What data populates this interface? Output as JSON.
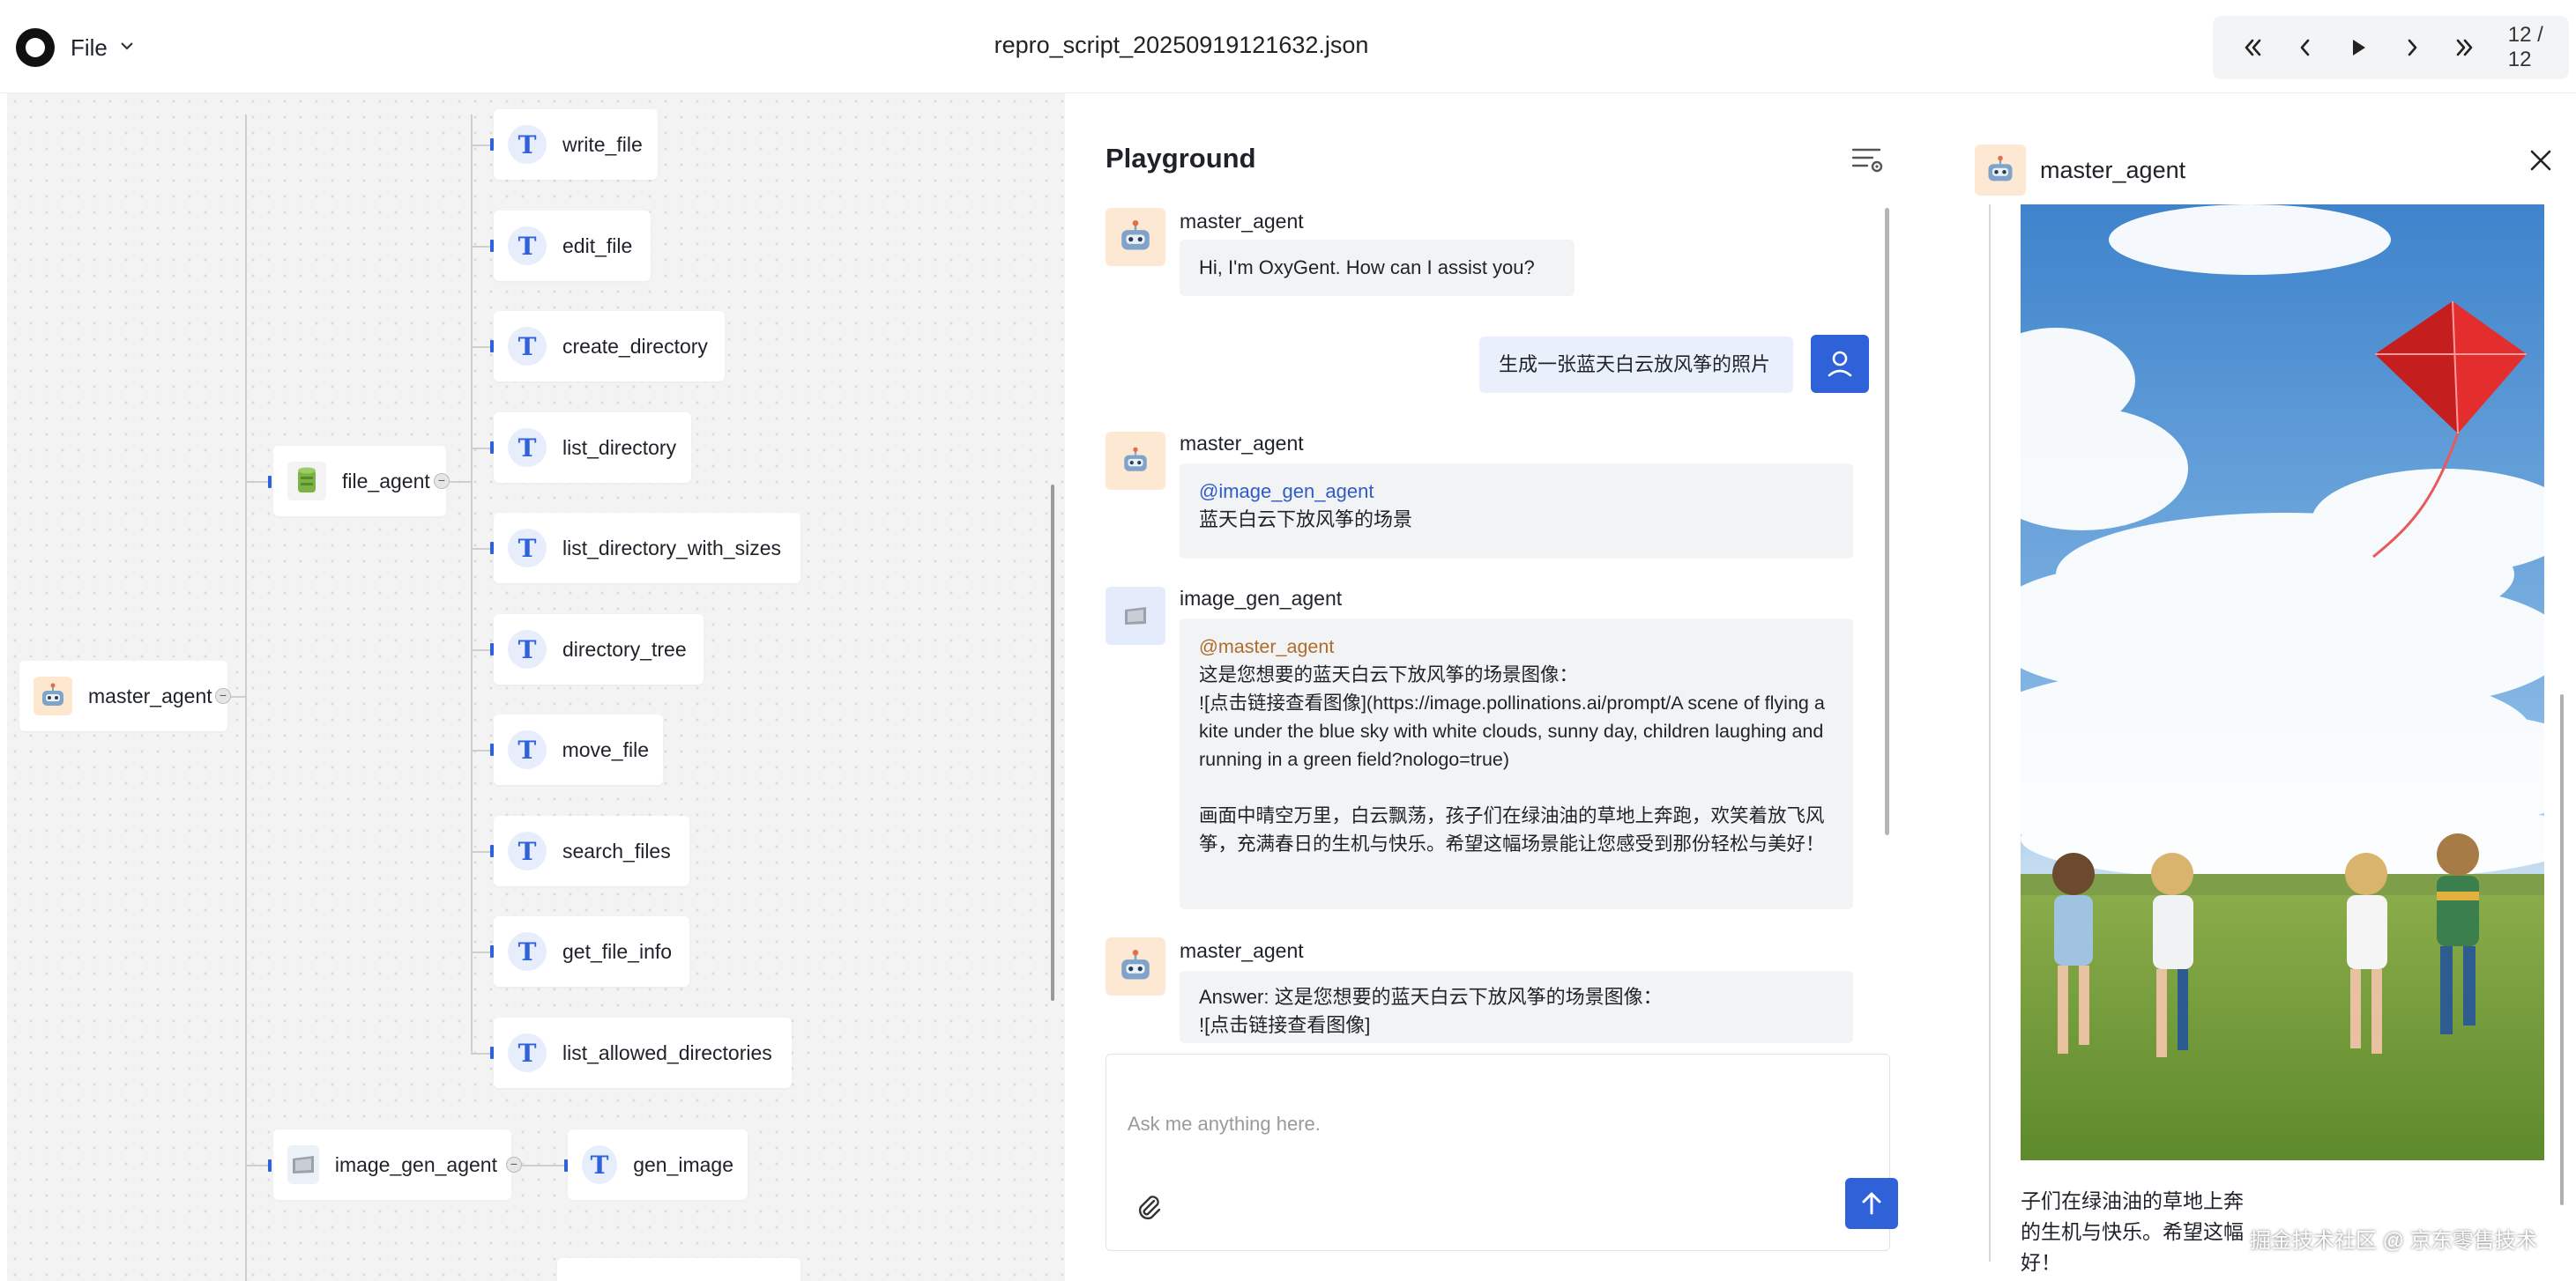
{
  "app": {
    "file_menu": "File",
    "document_title": "repro_script_20250919121632.json",
    "page_counter": "12 / 12"
  },
  "tree": {
    "root": "master_agent",
    "file_agent": "file_agent",
    "image_gen_agent": "image_gen_agent",
    "file_tools": [
      "write_file",
      "edit_file",
      "create_directory",
      "list_directory",
      "list_directory_with_sizes",
      "directory_tree",
      "move_file",
      "search_files",
      "get_file_info",
      "list_allowed_directories"
    ],
    "image_tools": [
      "gen_image"
    ]
  },
  "playground": {
    "title": "Playground",
    "input_placeholder": "Ask me anything here.",
    "messages": [
      {
        "sender": "master_agent",
        "text": "Hi, I'm OxyGent. How can I assist you?"
      },
      {
        "sender": "user",
        "text": "生成一张蓝天白云放风筝的照片"
      },
      {
        "sender": "master_agent",
        "mention": "@image_gen_agent",
        "text": "蓝天白云下放风筝的场景"
      },
      {
        "sender": "image_gen_agent",
        "mention": "@master_agent",
        "text": "这是您想要的蓝天白云下放风筝的场景图像：\n![点击链接查看图像](https://image.pollinations.ai/prompt/A scene of flying a kite under the blue sky with white clouds, sunny day, children laughing and running in a green field?nologo=true)\n\n画面中晴空万里，白云飘荡，孩子们在绿油油的草地上奔跑，欢笑着放飞风筝，充满春日的生机与快乐。希望这幅场景能让您感受到那份轻松与美好！"
      },
      {
        "sender": "master_agent",
        "text": "Answer: 这是您想要的蓝天白云下放风筝的场景图像：\n![点击链接查看图像]"
      }
    ]
  },
  "preview": {
    "title": "master_agent",
    "caption": "子们在绿油油的草地上奔的生机与快乐。希望这幅好！",
    "image_description": "kite-flying-children-photo",
    "watermark": "掘金技术社区 @ 京东零售技术"
  },
  "colors": {
    "accent": "#2f62d9",
    "canvas_bg": "#f3f3f3",
    "bubble_bg": "#f2f3f5",
    "agent_avatar_bg": "#fde9d3"
  }
}
